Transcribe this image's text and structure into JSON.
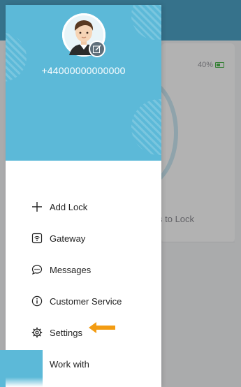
{
  "background": {
    "battery_text": "40%",
    "hint_text": "s to Lock",
    "paren_text": ")"
  },
  "drawer": {
    "phone": "+44000000000000",
    "menu": [
      {
        "label": "Add Lock",
        "icon": "plus-icon"
      },
      {
        "label": "Gateway",
        "icon": "router-icon"
      },
      {
        "label": "Messages",
        "icon": "chat-bubble-icon"
      },
      {
        "label": "Customer Service",
        "icon": "info-icon"
      },
      {
        "label": "Settings",
        "icon": "gear-icon"
      },
      {
        "label": "Work with",
        "icon": ""
      }
    ]
  },
  "colors": {
    "header_blue": "#5cb9d8",
    "annotation_arrow": "#f39c12"
  }
}
